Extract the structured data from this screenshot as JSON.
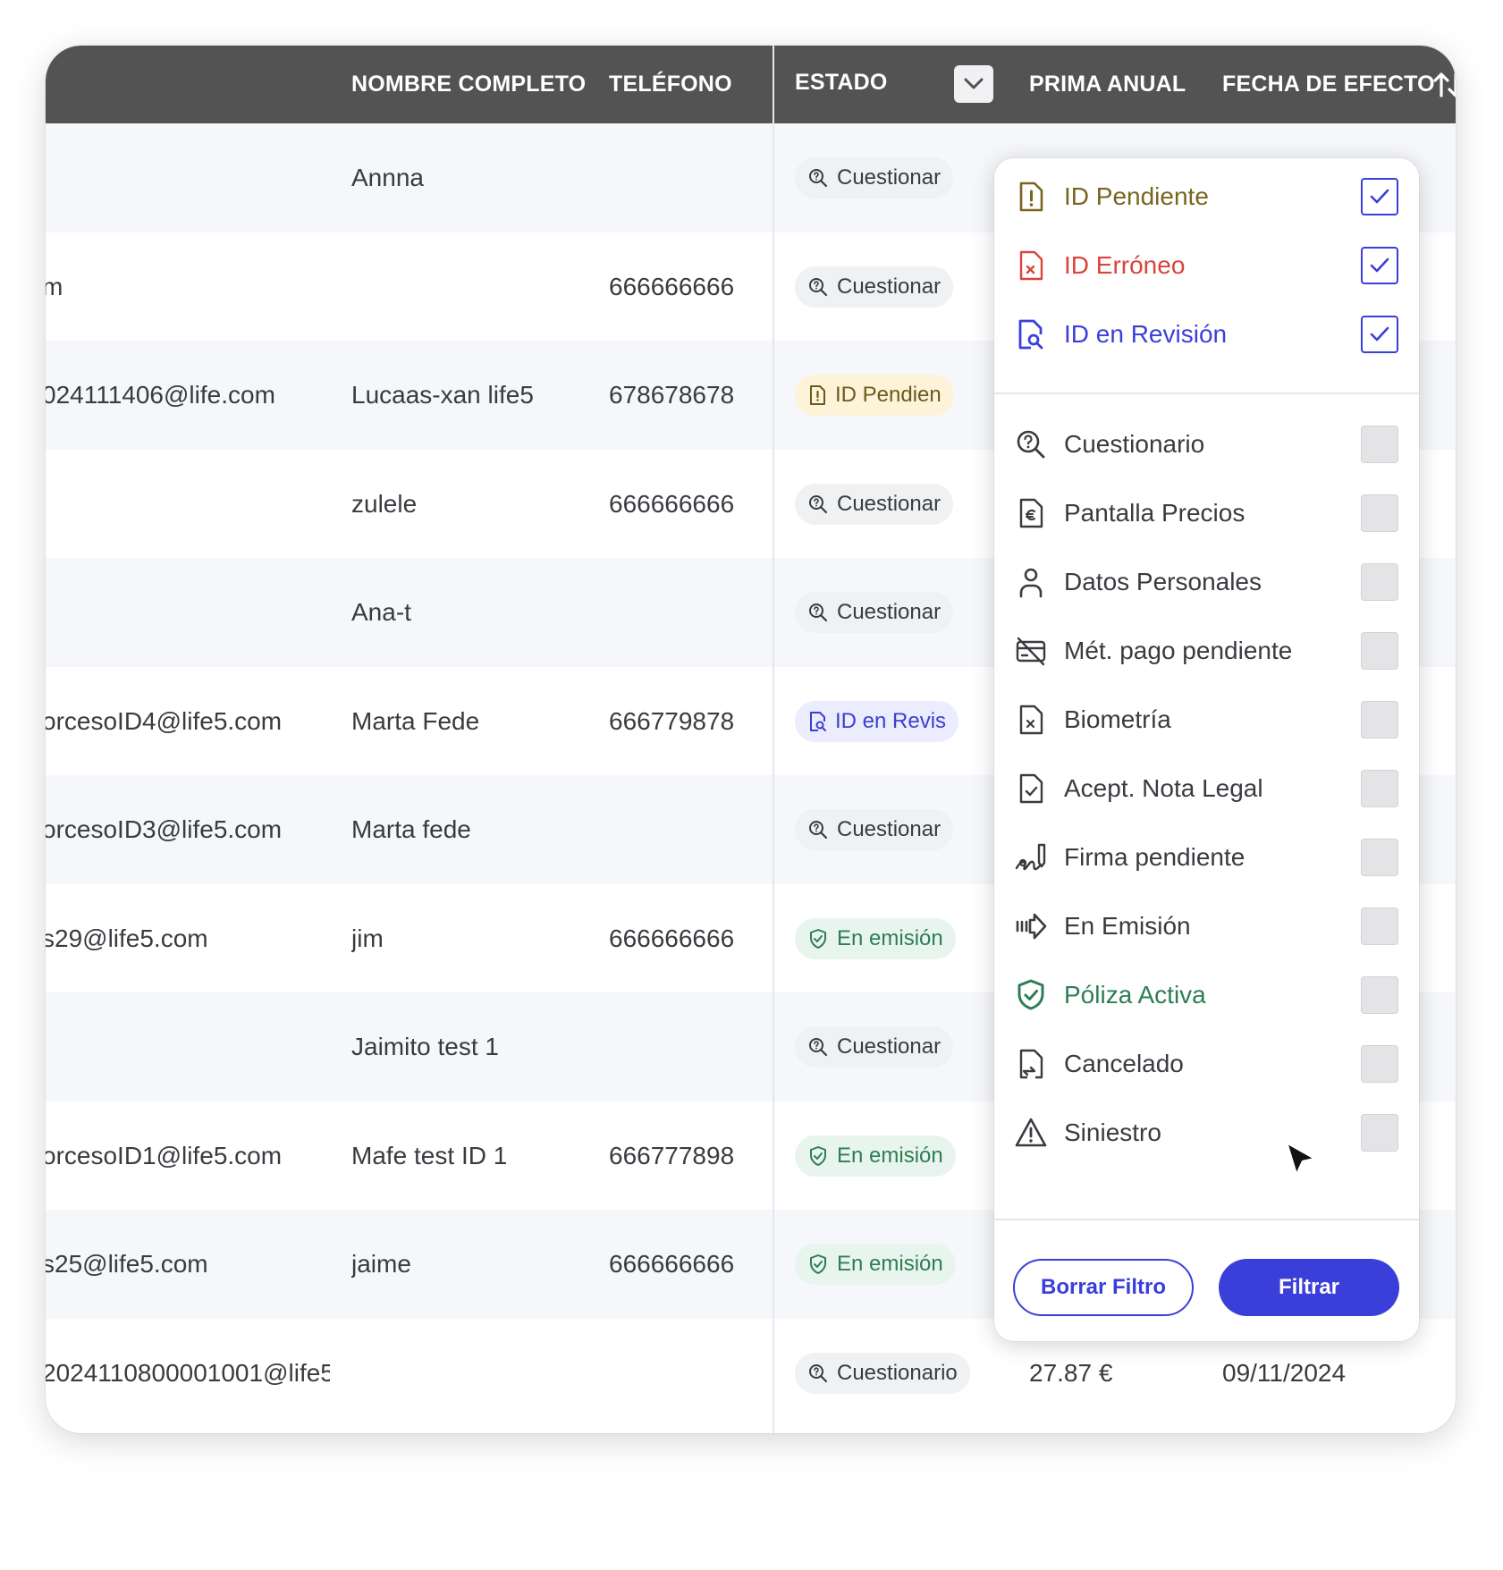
{
  "columns": {
    "name": "NOMBRE COMPLETO",
    "phone": "TELÉFONO",
    "status": "ESTADO",
    "prima": "PRIMA ANUAL",
    "fecha": "FECHA DE EFECTO"
  },
  "rows": [
    {
      "email": "",
      "name": "Annna",
      "phone": "",
      "status": "Cuestionar",
      "status_type": "cuestionario",
      "prima": "",
      "fecha": ""
    },
    {
      "email": "m",
      "name": "",
      "phone": "666666666",
      "status": "Cuestionar",
      "status_type": "cuestionario",
      "prima": "",
      "fecha": ""
    },
    {
      "email": "024111406@life.com",
      "name": "Lucaas-xan life5",
      "phone": "678678678",
      "status": "ID Pendien",
      "status_type": "id-pendiente",
      "prima": "",
      "fecha": ""
    },
    {
      "email": "",
      "name": "zulele",
      "phone": "666666666",
      "status": "Cuestionar",
      "status_type": "cuestionario",
      "prima": "",
      "fecha": ""
    },
    {
      "email": "",
      "name": "Ana-t",
      "phone": "",
      "status": "Cuestionar",
      "status_type": "cuestionario",
      "prima": "",
      "fecha": ""
    },
    {
      "email": "orcesoID4@life5.com",
      "name": "Marta Fede",
      "phone": "666779878",
      "status": "ID en Revis",
      "status_type": "id-revision",
      "prima": "",
      "fecha": ""
    },
    {
      "email": "orcesoID3@life5.com",
      "name": "Marta fede",
      "phone": "",
      "status": "Cuestionar",
      "status_type": "cuestionario",
      "prima": "",
      "fecha": ""
    },
    {
      "email": "s29@life5.com",
      "name": "jim",
      "phone": "666666666",
      "status": "En emisión",
      "status_type": "en-emision",
      "prima": "",
      "fecha": ""
    },
    {
      "email": "",
      "name": "Jaimito test 1",
      "phone": "",
      "status": "Cuestionar",
      "status_type": "cuestionario",
      "prima": "",
      "fecha": ""
    },
    {
      "email": "orcesoID1@life5.com",
      "name": "Mafe test ID 1",
      "phone": "666777898",
      "status": "En emisión",
      "status_type": "en-emision",
      "prima": "",
      "fecha": ""
    },
    {
      "email": "s25@life5.com",
      "name": "jaime",
      "phone": "666666666",
      "status": "En emisión",
      "status_type": "en-emision",
      "prima": "",
      "fecha": ""
    },
    {
      "email": "2024110800001001@life5",
      "name": "",
      "phone": "",
      "status": "Cuestionario",
      "status_type": "cuestionario",
      "prima": "27.87 €",
      "fecha": "09/11/2024"
    }
  ],
  "filter": {
    "options": [
      {
        "label": "ID Pendiente",
        "icon": "id-pending-icon",
        "color": "#7a6420",
        "checked": true
      },
      {
        "label": "ID Erróneo",
        "icon": "id-error-icon",
        "color": "#d9443b",
        "checked": true
      },
      {
        "label": "ID en Revisión",
        "icon": "id-review-icon",
        "color": "#3b3fd9",
        "checked": true
      },
      {
        "label": "Cuestionario",
        "icon": "questionnaire-icon",
        "color": "#3a3b40",
        "checked": false
      },
      {
        "label": "Pantalla Precios",
        "icon": "price-doc-icon",
        "color": "#3a3b40",
        "checked": false
      },
      {
        "label": "Datos Personales",
        "icon": "person-icon",
        "color": "#3a3b40",
        "checked": false
      },
      {
        "label": "Mét. pago pendiente",
        "icon": "card-off-icon",
        "color": "#3a3b40",
        "checked": false
      },
      {
        "label": "Biometría",
        "icon": "biometry-doc-icon",
        "color": "#3a3b40",
        "checked": false
      },
      {
        "label": "Acept. Nota Legal",
        "icon": "doc-check-icon",
        "color": "#3a3b40",
        "checked": false
      },
      {
        "label": "Firma pendiente",
        "icon": "signature-icon",
        "color": "#3a3b40",
        "checked": false
      },
      {
        "label": "En Emisión",
        "icon": "arrow-emission-icon",
        "color": "#3a3b40",
        "checked": false
      },
      {
        "label": "Póliza Activa",
        "icon": "shield-check-icon",
        "color": "#2e7d55",
        "checked": false
      },
      {
        "label": "Cancelado",
        "icon": "doc-cancel-icon",
        "color": "#3a3b40",
        "checked": false
      },
      {
        "label": "Siniestro",
        "icon": "warning-icon",
        "color": "#3a3b40",
        "checked": false
      }
    ],
    "clear_label": "Borrar Filtro",
    "apply_label": "Filtrar"
  }
}
